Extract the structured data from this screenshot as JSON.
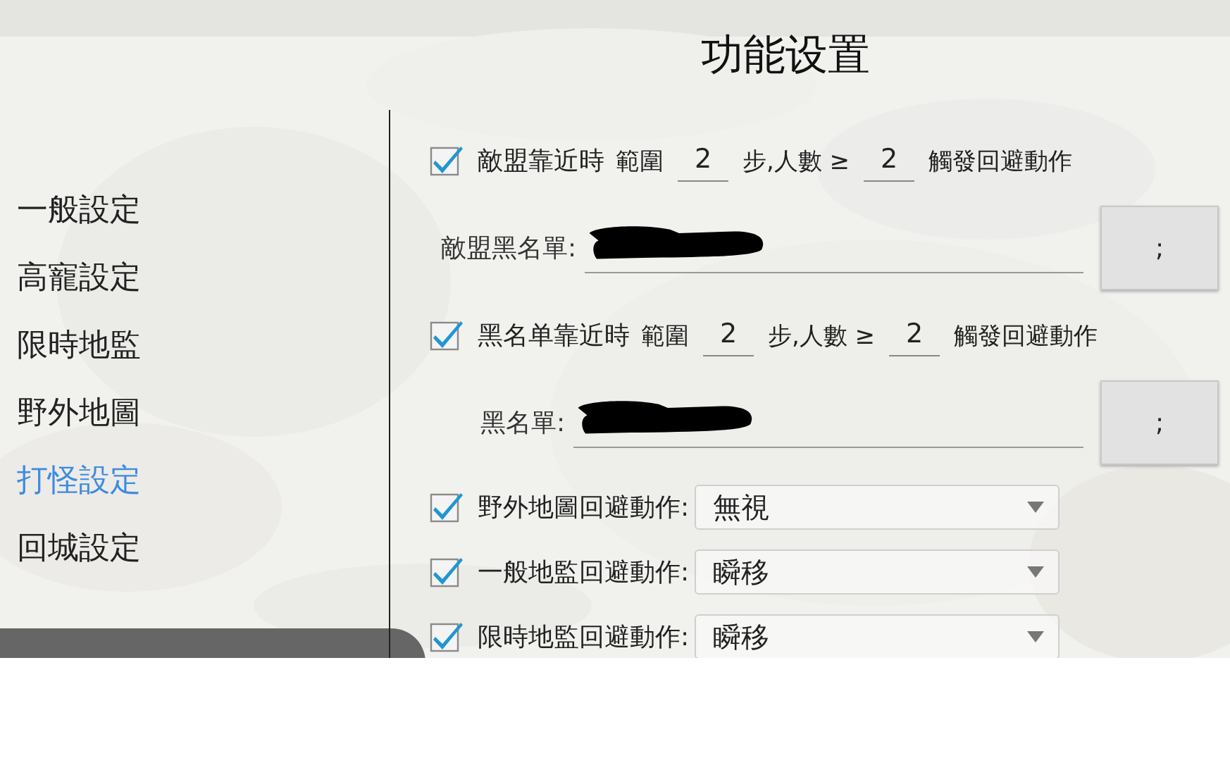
{
  "title": "功能设置",
  "menu": [
    {
      "label": "一般設定",
      "selected": false
    },
    {
      "label": "高寵設定",
      "selected": false
    },
    {
      "label": "限時地監",
      "selected": false
    },
    {
      "label": "野外地圖",
      "selected": false
    },
    {
      "label": "打怪設定",
      "selected": true
    },
    {
      "label": "回城設定",
      "selected": false
    }
  ],
  "settings": [
    {
      "kind": "proximity",
      "checked": true,
      "label": "敵盟靠近時",
      "range_label": "範圍",
      "range": "2",
      "steps_label": "步,人數 ≥",
      "count": "2",
      "action_label": "觸發回避動作"
    },
    {
      "kind": "list",
      "label": "敵盟黑名單:",
      "button": ";"
    },
    {
      "kind": "proximity",
      "checked": true,
      "label": "黑名单靠近時",
      "range_label": "範圍",
      "range": "2",
      "steps_label": "步,人數 ≥",
      "count": "2",
      "action_label": "觸發回避動作"
    },
    {
      "kind": "list",
      "label": "黑名單:",
      "button": ";"
    },
    {
      "kind": "select",
      "checked": true,
      "label": "野外地圖回避動作:",
      "value": "無視"
    },
    {
      "kind": "select",
      "checked": true,
      "label": "一般地監回避動作:",
      "value": "瞬移"
    },
    {
      "kind": "select",
      "checked": true,
      "label": "限時地監回避動作:",
      "value": "瞬移"
    }
  ]
}
